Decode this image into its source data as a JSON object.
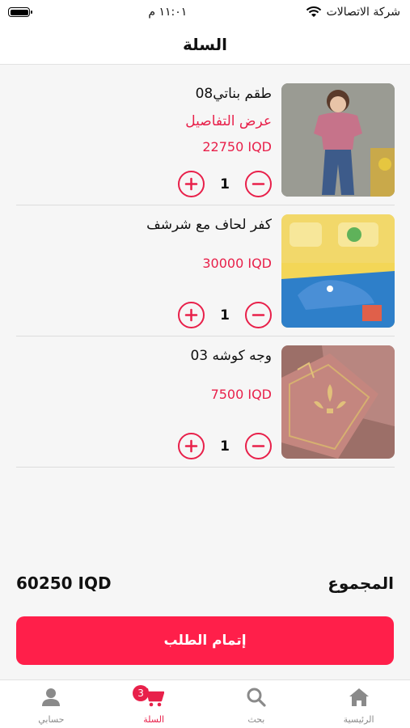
{
  "status_bar": {
    "carrier": "شركة الاتصالات",
    "time": "١١:٠١ م"
  },
  "header": {
    "title": "السلة"
  },
  "cart": {
    "items": [
      {
        "name": "طقم بناتي08",
        "details_link": "عرض التفاصيل",
        "price": "22750 IQD",
        "quantity": "1"
      },
      {
        "name": "كفر لحاف مع شرشف",
        "details_link": "",
        "price": "30000 IQD",
        "quantity": "1"
      },
      {
        "name": "وجه كوشه 03",
        "details_link": "",
        "price": "7500 IQD",
        "quantity": "1"
      }
    ]
  },
  "total": {
    "label": "المجموع",
    "amount": "60250 IQD"
  },
  "checkout": {
    "label": "إتمام الطلب"
  },
  "tabs": [
    {
      "label": "حسابي",
      "icon": "person-icon"
    },
    {
      "label": "السلة",
      "icon": "cart-icon",
      "badge": "3",
      "active": true
    },
    {
      "label": "بحث",
      "icon": "search-icon"
    },
    {
      "label": "الرئيسية",
      "icon": "home-icon"
    }
  ],
  "colors": {
    "accent": "#e8204a",
    "checkout_bg": "#ff1f4a",
    "tab_inactive": "#8a8a8a"
  }
}
